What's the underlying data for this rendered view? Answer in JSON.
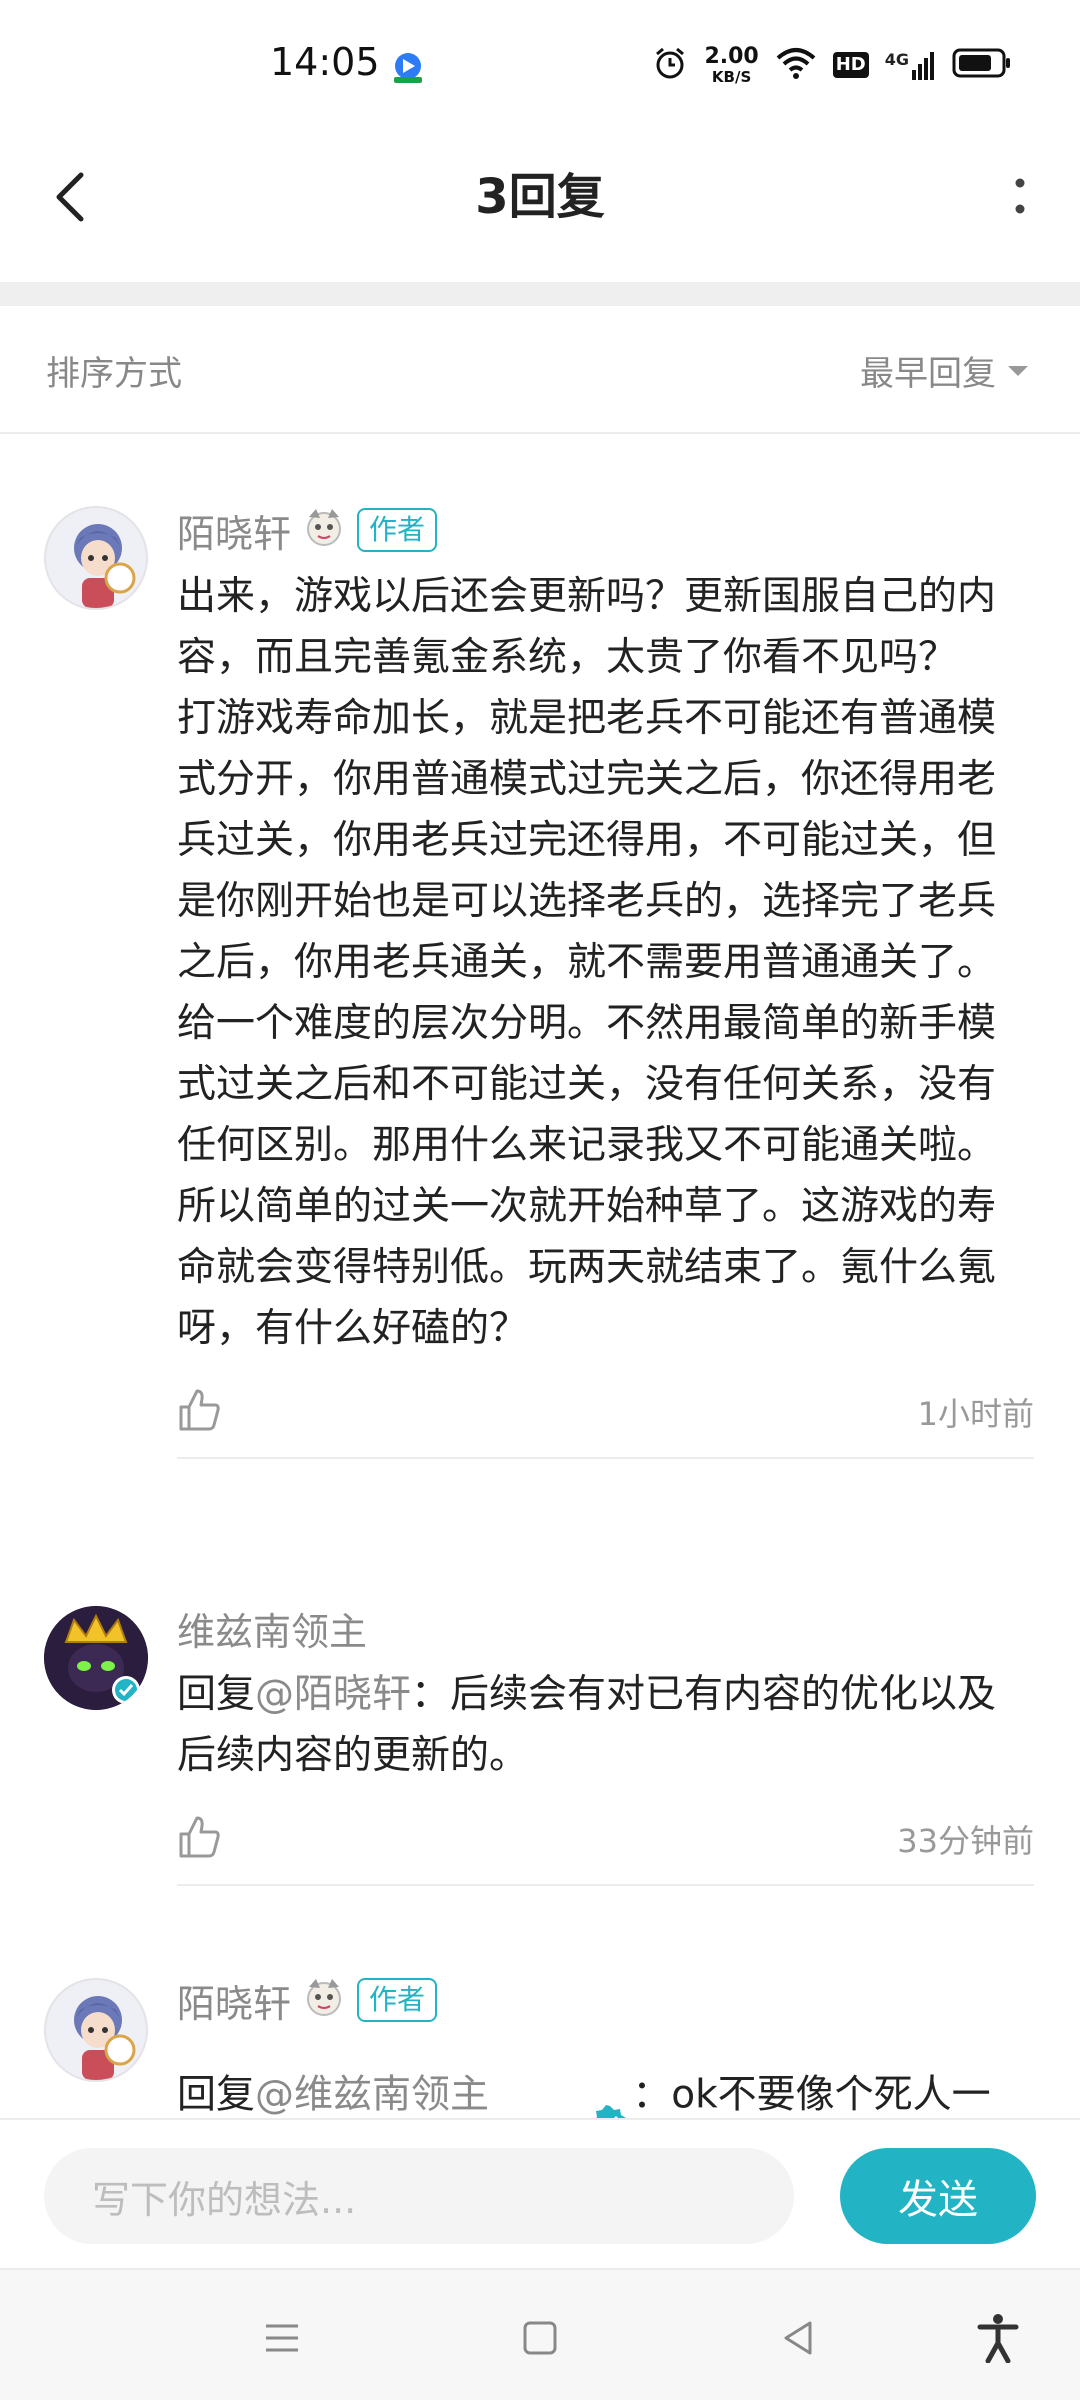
{
  "status": {
    "time": "14:05",
    "speed_value": "2.00",
    "speed_unit": "KB/S",
    "hd_label": "HD",
    "network_label": "4G"
  },
  "header": {
    "title": "3回复"
  },
  "sort": {
    "label": "排序方式",
    "selected": "最早回复"
  },
  "comments": [
    {
      "name": "陌晓轩",
      "badge": "作者",
      "text": "出来，游戏以后还会更新吗？更新国服自己的内容，而且完善氪金系统，太贵了你看不见吗？\n打游戏寿命加长，就是把老兵不可能还有普通模式分开，你用普通模式过完关之后，你还得用老兵过关，你用老兵过完还得用，不可能过关，但是你刚开始也是可以选择老兵的，选择完了老兵之后，你用老兵通关，就不需要用普通通关了。给一个难度的层次分明。不然用最简单的新手模式过关之后和不可能过关，没有任何关系，没有任何区别。那用什么来记录我又不可能通关啦。所以简单的过关一次就开始种草了。这游戏的寿命就会变得特别低。玩两天就结束了。氪什么氪呀，有什么好磕的？",
      "time": "1小时前"
    },
    {
      "name": "维兹南领主",
      "reply_prefix": "回复",
      "mention": "@陌晓轩",
      "text": "：后续会有对已有内容的优化以及后续内容的更新的。",
      "time": "33分钟前"
    },
    {
      "name": "陌晓轩",
      "badge": "作者",
      "reply_prefix": "回复",
      "mention": "@维兹南领主",
      "text": "：ok不要像个死人一样，"
    }
  ],
  "input": {
    "placeholder": "写下你的想法...",
    "send_label": "发送"
  },
  "colors": {
    "accent": "#22b3c4",
    "secondary_text": "#8a8a8a"
  }
}
